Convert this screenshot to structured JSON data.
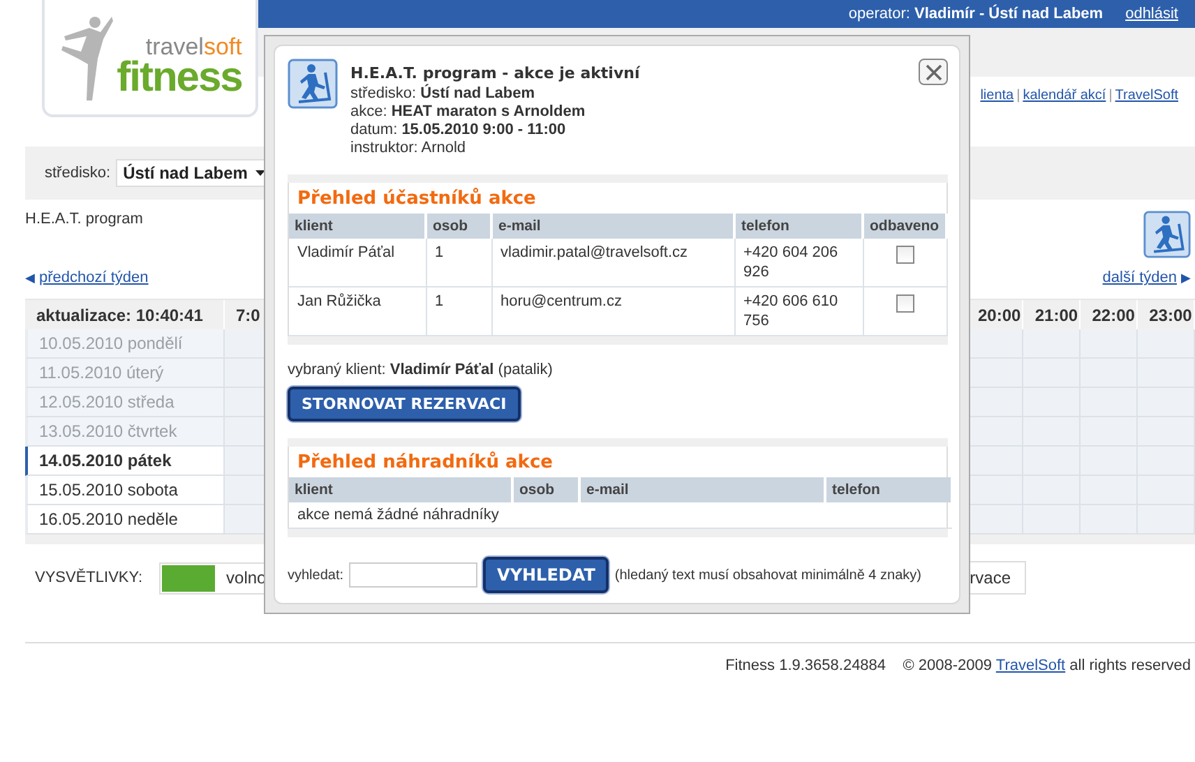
{
  "header": {
    "operator_label": "operator:",
    "operator": "Vladimír - Ústí nad Labem",
    "logout": "odhlásit"
  },
  "logo": {
    "travel": "travel",
    "soft": "soft",
    "fitness": "fitness"
  },
  "nav": {
    "separator": "|",
    "links": [
      "lienta",
      "kalendář akcí",
      "TravelSoft"
    ]
  },
  "filter": {
    "label": "středisko:",
    "value": "Ústí nad Labem"
  },
  "program": "H.E.A.T. program",
  "week_nav": {
    "prev_arrow": "◀",
    "prev": "předchozí týden",
    "next": "další týden",
    "next_arrow": "▶"
  },
  "schedule": {
    "corner": "aktualizace: 10:40:41",
    "first_hour": "7:0",
    "last_hours": [
      "20:00",
      "21:00",
      "22:00",
      "23:00"
    ],
    "days": [
      {
        "label": "10.05.2010 pondělí",
        "past": true,
        "selected": false
      },
      {
        "label": "11.05.2010 úterý",
        "past": true,
        "selected": false
      },
      {
        "label": "12.05.2010 středa",
        "past": true,
        "selected": false
      },
      {
        "label": "13.05.2010 čtvrtek",
        "past": true,
        "selected": false
      },
      {
        "label": "14.05.2010 pátek",
        "past": false,
        "selected": true
      },
      {
        "label": "15.05.2010 sobota",
        "past": false,
        "selected": false
      },
      {
        "label": "16.05.2010 neděle",
        "past": false,
        "selected": false
      }
    ]
  },
  "legend": {
    "label": "VYSVĚTLIVKY:",
    "items": [
      {
        "label": "volno",
        "color": "#5aab32"
      }
    ],
    "last_item": "rvace"
  },
  "footer": {
    "version": "Fitness 1.9.3658.24884",
    "copyright": "© 2008-2009",
    "link": "TravelSoft",
    "rights": "all rights reserved"
  },
  "dialog": {
    "title": "H.E.A.T. program - akce je aktivní",
    "details": [
      "středisko: **Ústí nad Labem**",
      "akce: **HEAT maraton s Arnoldem**",
      "datum: **15.05.2010 9:00 - 11:00**",
      "instruktor: Arnold"
    ],
    "participants": {
      "title": "Přehled účastníků akce",
      "columns": [
        "klient",
        "osob",
        "e-mail",
        "telefon",
        "odbaveno"
      ],
      "rows": [
        {
          "client": "Vladimír Páťal",
          "persons": "1",
          "email": "vladimir.patal@travelsoft.cz",
          "phone": "+420 604 206 926",
          "checked": false
        },
        {
          "client": "Jan Růžička",
          "persons": "1",
          "email": "horu@centrum.cz",
          "phone": "+420 606 610 756",
          "checked": false
        }
      ]
    },
    "selected_client": "vybraný klient: **Vladimír Páťal** (patalik)",
    "cancel_button": "STORNOVAT REZERVACI",
    "substitutes": {
      "title": "Přehled náhradníků akce",
      "columns": [
        "klient",
        "osob",
        "e-mail",
        "telefon"
      ],
      "empty": "akce nemá žádné náhradníky"
    },
    "search": {
      "label": "vyhledat:",
      "button": "VYHLEDAT",
      "hint": "(hledaný text musí obsahovat minimálně 4 znaky)"
    }
  }
}
